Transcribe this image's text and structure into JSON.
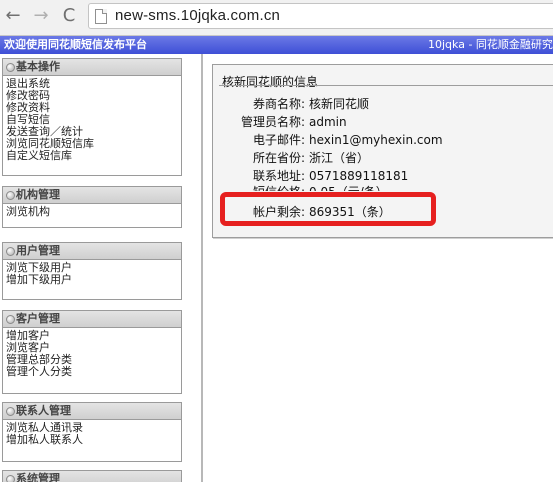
{
  "browser": {
    "url": "new-sms.10jqka.com.cn",
    "back_glyph": "←",
    "forward_glyph": "→",
    "reload_glyph": "C"
  },
  "titlebar": {
    "left": "欢迎使用同花顺短信发布平台",
    "right": "10jqka - 同花顺金融研究"
  },
  "sidebar": {
    "groups": [
      {
        "title": "基本操作",
        "items": [
          "退出系统",
          "修改密码",
          "修改资料",
          "自写短信",
          "发送查询／统计",
          "浏览同花顺短信库",
          "自定义短信库"
        ]
      },
      {
        "title": "机构管理",
        "items": [
          "浏览机构"
        ]
      },
      {
        "title": "用户管理",
        "items": [
          "浏览下级用户",
          "增加下级用户"
        ]
      },
      {
        "title": "客户管理",
        "items": [
          "增加客户",
          "浏览客户",
          "管理总部分类",
          "管理个人分类"
        ]
      },
      {
        "title": "联系人管理",
        "items": [
          "浏览私人通讯录",
          "增加私人联系人"
        ]
      },
      {
        "title": "系统管理",
        "items": []
      }
    ]
  },
  "info": {
    "title": "核新同花顺的信息",
    "rows": [
      {
        "label": "券商名称:",
        "value": "核新同花顺"
      },
      {
        "label": "管理员名称:",
        "value": "admin"
      },
      {
        "label": "电子邮件:",
        "value": "hexin1@myhexin.com"
      },
      {
        "label": "所在省份:",
        "value": "浙江（省）"
      },
      {
        "label": "联系地址:",
        "value": "0571889118181"
      },
      {
        "label": "短信价格:",
        "value": "0.05（元/条）"
      },
      {
        "label": "帐户剩余:",
        "value": "869351（条）"
      }
    ]
  },
  "colors": {
    "titlebar": "#3e4fd6",
    "highlight": "#e6201f"
  }
}
